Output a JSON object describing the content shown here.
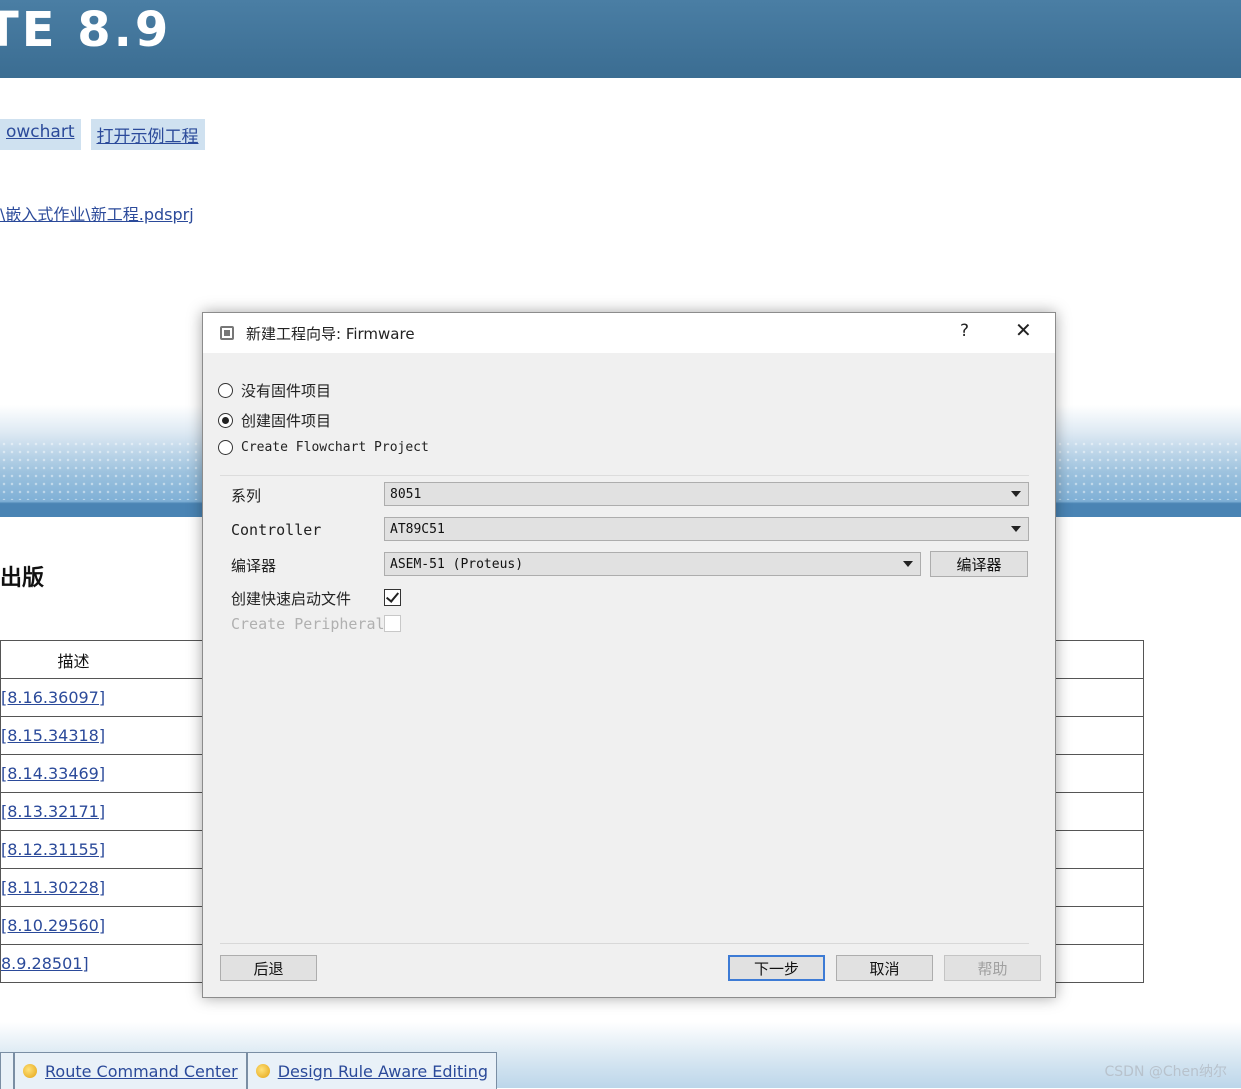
{
  "background": {
    "banner_title": "TE 8.9",
    "links": [
      "owchart",
      "打开示例工程"
    ],
    "recent_path": "\\嵌入式作业\\新工程.pdsprj",
    "section_heading": "出版",
    "table_header": "描述",
    "versions": [
      "[8.16.36097]",
      "[8.15.34318]",
      "[8.14.33469]",
      "[8.13.32171]",
      "[8.12.31155]",
      "[8.11.30228]",
      "[8.10.29560]",
      "8.9.28501]"
    ],
    "bottom_tabs": [
      "Route Command Center",
      "Design Rule Aware Editing"
    ],
    "watermark": "CSDN @Chen纳尔"
  },
  "dialog": {
    "title": "新建工程向导: Firmware",
    "help_label": "?",
    "close_label": "✕",
    "options": [
      {
        "label": "没有固件项目",
        "checked": false
      },
      {
        "label": "创建固件项目",
        "checked": true
      },
      {
        "label": "Create Flowchart Project",
        "checked": false
      }
    ],
    "fields": {
      "family_label": "系列",
      "family_value": "8051",
      "controller_label": "Controller",
      "controller_value": "AT89C51",
      "compiler_label": "编译器",
      "compiler_value": "ASEM-51 (Proteus)",
      "compiler_button": "编译器",
      "quickstart_label": "创建快速启动文件",
      "quickstart_checked": true,
      "peripherals_label": "Create Peripherals",
      "peripherals_checked": false
    },
    "buttons": {
      "back": "后退",
      "next": "下一步",
      "cancel": "取消",
      "help": "帮助"
    }
  }
}
